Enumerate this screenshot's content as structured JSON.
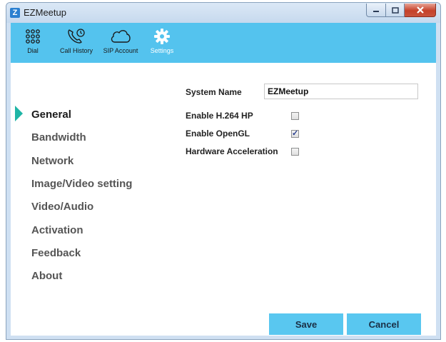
{
  "window": {
    "title": "EZMeetup",
    "app_icon_glyph": "Z"
  },
  "toolbar": {
    "items": [
      {
        "label": "Dial",
        "icon": "dialpad-icon"
      },
      {
        "label": "Call History",
        "icon": "phone-history-icon"
      },
      {
        "label": "SIP Account",
        "icon": "cloud-icon"
      },
      {
        "label": "Settings",
        "icon": "gear-icon",
        "active": true
      }
    ]
  },
  "sidebar": {
    "items": [
      {
        "label": "General",
        "active": true
      },
      {
        "label": "Bandwidth"
      },
      {
        "label": "Network"
      },
      {
        "label": "Image/Video setting"
      },
      {
        "label": "Video/Audio"
      },
      {
        "label": "Activation"
      },
      {
        "label": "Feedback"
      },
      {
        "label": "About"
      }
    ]
  },
  "general": {
    "system_name_label": "System Name",
    "system_name_value": "EZMeetup",
    "h264_label": "Enable H.264 HP",
    "h264_checked": false,
    "opengl_label": "Enable OpenGL",
    "opengl_checked": true,
    "hwaccel_label": "Hardware Acceleration",
    "hwaccel_checked": false
  },
  "actions": {
    "save_label": "Save",
    "cancel_label": "Cancel"
  },
  "colors": {
    "toolbar": "#54c3ee",
    "accent_arrow": "#1fb5a6",
    "button": "#59c7f0"
  }
}
